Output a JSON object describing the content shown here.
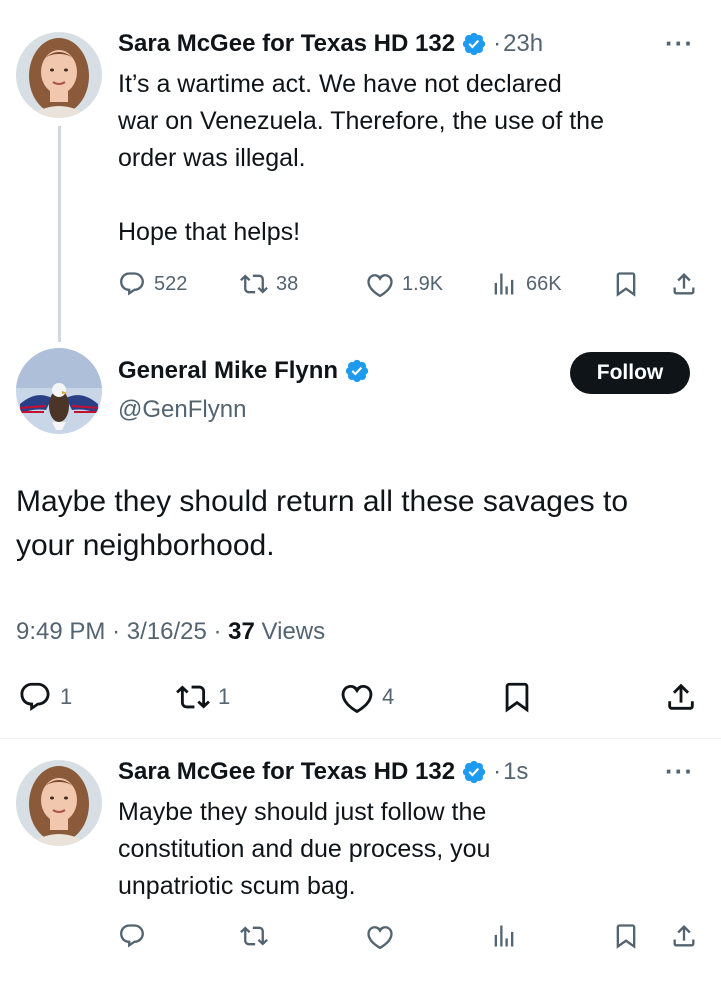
{
  "tweet1": {
    "name": "Sara McGee for Texas HD 132",
    "time": "23h",
    "more_icon": "more-horizontal-icon",
    "lines": [
      "It’s a wartime act. We have not declared",
      "war on Venezuela. Therefore, the use of the",
      "order was illegal.",
      "",
      "Hope that helps!"
    ],
    "replies": "522",
    "reposts": "38",
    "likes": "1.9K",
    "views": "66K"
  },
  "main_tweet": {
    "name": "General Mike Flynn",
    "handle": "@GenFlynn",
    "follow_label": "Follow",
    "lines": [
      "Maybe they should return all these savages to",
      "your neighborhood."
    ],
    "time": "9:49 PM",
    "date": "3/16/25",
    "views_count": "37",
    "views_label": "Views",
    "replies": "1",
    "reposts": "1",
    "likes": "4"
  },
  "reply_tweet": {
    "name": "Sara McGee for Texas HD 132",
    "time": "1s",
    "lines": [
      "Maybe they should just follow the",
      "constitution and due process, you",
      "unpatriotic scum bag."
    ]
  },
  "colors": {
    "verified": "#1d9bf0",
    "text": "#0f1419",
    "muted": "#536471",
    "button": "#0f1419"
  }
}
